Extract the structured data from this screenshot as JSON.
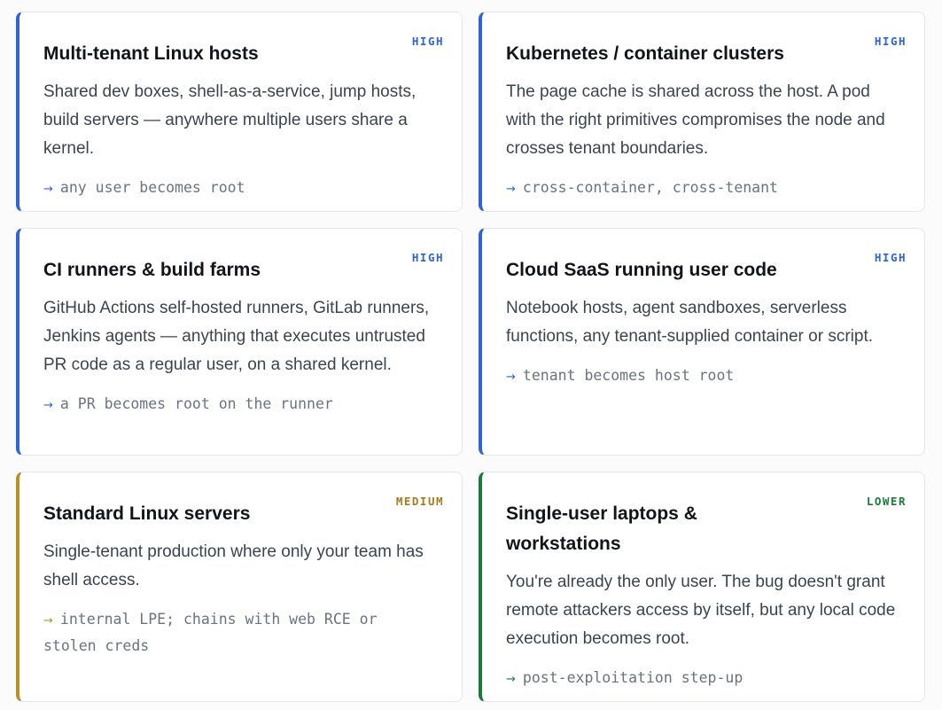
{
  "cards": [
    {
      "title": "Multi-tenant Linux hosts",
      "badge": "HIGH",
      "description": "Shared dev boxes, shell-as-a-service, jump hosts, build servers — anywhere multiple users share a kernel.",
      "impact": "any user becomes root"
    },
    {
      "title": "Kubernetes / container clusters",
      "badge": "HIGH",
      "description": "The page cache is shared across the host. A pod with the right primitives compromises the node and crosses tenant boundaries.",
      "impact": "cross-container, cross-tenant"
    },
    {
      "title": "CI runners & build farms",
      "badge": "HIGH",
      "description": "GitHub Actions self-hosted runners, GitLab runners, Jenkins agents — anything that executes untrusted PR code as a regular user, on a shared kernel.",
      "impact": "a PR becomes root on the runner"
    },
    {
      "title": "Cloud SaaS running user code",
      "badge": "HIGH",
      "description": "Notebook hosts, agent sandboxes, serverless functions, any tenant-supplied container or script.",
      "impact": "tenant becomes host root"
    },
    {
      "title": "Standard Linux servers",
      "badge": "MEDIUM",
      "description": "Single-tenant production where only your team has shell access.",
      "impact": "internal LPE; chains with web RCE or stolen creds"
    },
    {
      "title": "Single-user laptops & workstations",
      "badge": "LOWER",
      "description": "You're already the only user. The bug doesn't grant remote attackers access by itself, but any local code execution becomes root.",
      "impact": "post-exploitation step-up"
    }
  ],
  "arrow_symbol": "→",
  "colors": {
    "high": "#2f63d6",
    "medium": "#b8902a",
    "lower": "#1c7a3c"
  }
}
